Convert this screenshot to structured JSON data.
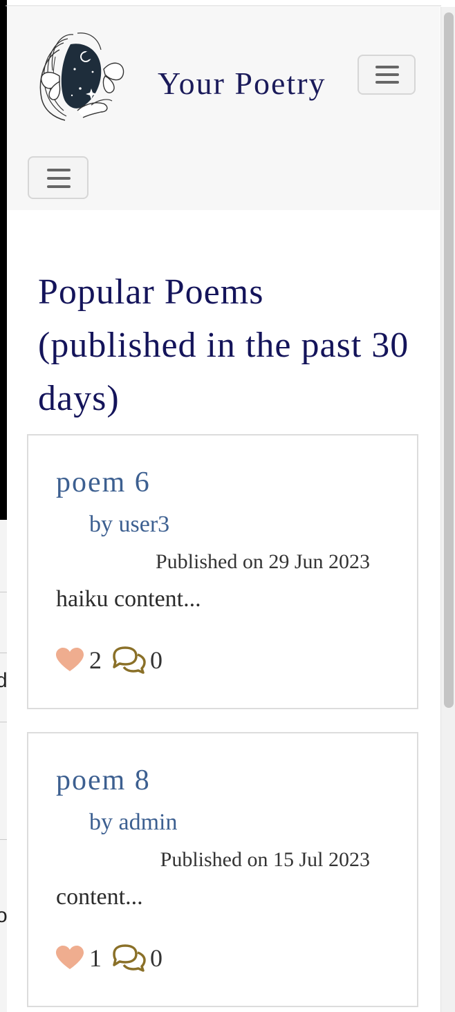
{
  "navbar": {
    "brand": "Your Poetry",
    "logo_icon": "woman-butterfly-logo"
  },
  "page": {
    "title": "Popular Poems (published in the past 30 days)"
  },
  "poems": [
    {
      "title": "poem 6",
      "author": "by user3",
      "published": "Published on 29 Jun 2023",
      "excerpt": "haiku content...",
      "likes": "2",
      "comments": "0"
    },
    {
      "title": "poem 8",
      "author": "by admin",
      "published": "Published on 15 Jul 2023",
      "excerpt": "content...",
      "likes": "1",
      "comments": "0"
    }
  ],
  "background": {
    "partial_chars": [
      "d",
      "o"
    ]
  },
  "colors": {
    "brand": "#1b1b5a",
    "link": "#3c5f90",
    "heart": "#efad8f",
    "comment": "#8a7028",
    "navbar_bg": "#f7f7f7"
  }
}
